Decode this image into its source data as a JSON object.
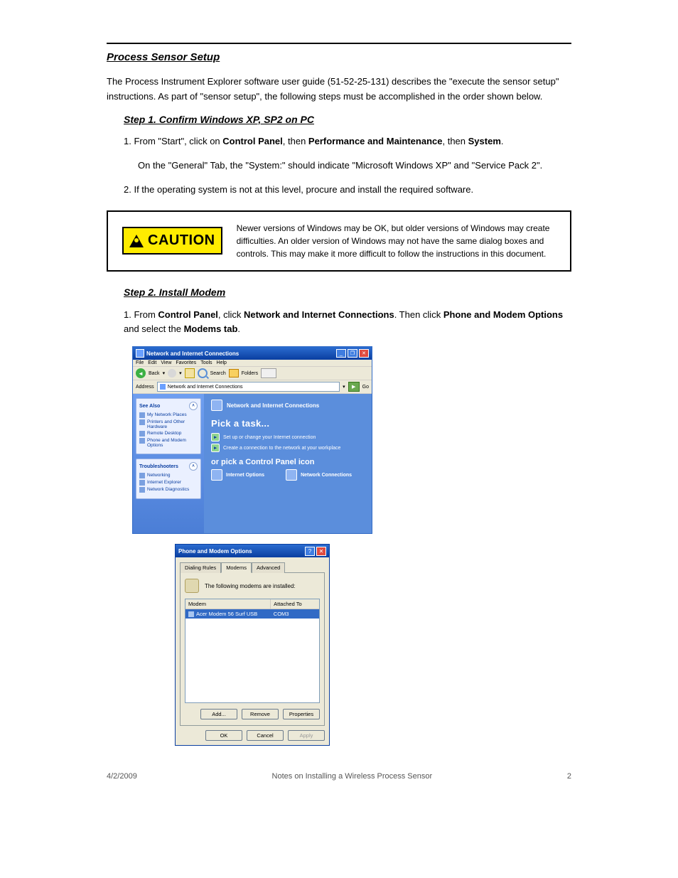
{
  "section_title": "Process Sensor Setup",
  "intro": "The Process Instrument Explorer software user guide (51-52-25-131) describes the \"execute the sensor setup\" instructions.  As part of \"sensor setup\", the following steps must be accomplished in the order shown below.",
  "step1": {
    "title": "Step 1.  Confirm Windows XP, SP2 on PC",
    "line1_a": "1.  From \"Start\", click on ",
    "line1_b": "Control Panel",
    "line1_c": ", then ",
    "line1_d": "Performance and Maintenance",
    "line1_e": ", then ",
    "line1_f": "System",
    "line1_g": ".",
    "line2": "On the \"General\" Tab, the \"System:\" should indicate \"Microsoft Windows XP\" and \"Service Pack 2\".",
    "line3": "2.  If the operating system is not at this level, procure and install the required software."
  },
  "caution": "Newer versions of Windows may be OK, but older versions of Windows may create difficulties.  An older version of Windows may not have the same dialog boxes and controls.  This may make it more difficult to follow the instructions in this document.",
  "caution_badge": "CAUTION",
  "step2": {
    "title": "Step 2.  Install Modem",
    "line1_a": "1.  From ",
    "line1_b": "Control Panel",
    "line1_c": ", click ",
    "line1_d": "Network and Internet Connections",
    "line1_e": ".  Then click ",
    "line1_f": "Phone and Modem Options",
    "line1_g": " and select the ",
    "line1_h": "Modems tab",
    "line1_i": "."
  },
  "win1": {
    "title": "Network and Internet Connections",
    "menus": [
      "File",
      "Edit",
      "View",
      "Favorites",
      "Tools",
      "Help"
    ],
    "back": "Back",
    "search": "Search",
    "folders": "Folders",
    "addr_label": "Address",
    "addr_value": "Network and Internet Connections",
    "go": "Go",
    "side_panels": {
      "see_also": {
        "title": "See Also",
        "items": [
          "My Network Places",
          "Printers and Other Hardware",
          "Remote Desktop",
          "Phone and Modem Options"
        ]
      },
      "troubleshooters": {
        "title": "Troubleshooters",
        "items": [
          "Networking",
          "Internet Explorer",
          "Network Diagnostics"
        ]
      }
    },
    "main": {
      "header": "Network and Internet Connections",
      "pick_task": "Pick a task...",
      "tasks": [
        "Set up or change your Internet connection",
        "Create a connection to the network at your workplace"
      ],
      "or_pick": "or pick a Control Panel icon",
      "cp_icons": [
        "Internet Options",
        "Network Connections"
      ]
    },
    "winbtns": {
      "min": "_",
      "max": "❐",
      "close": "✕"
    }
  },
  "win2": {
    "title": "Phone and Modem Options",
    "qmark": "?",
    "close": "✕",
    "tabs": [
      "Dialing Rules",
      "Modems",
      "Advanced"
    ],
    "active_tab": 1,
    "label": "The following modems are installed:",
    "col_modem": "Modem",
    "col_attached": "Attached To",
    "row_modem": "Acer Modem 56 Surf USB",
    "row_port": "COM3",
    "btn_add": "Add...",
    "btn_remove": "Remove",
    "btn_props": "Properties",
    "btn_ok": "OK",
    "btn_cancel": "Cancel",
    "btn_apply": "Apply"
  },
  "footer": {
    "left": "4/2/2009",
    "center": "Notes on Installing a Wireless Process Sensor",
    "right": "2"
  }
}
